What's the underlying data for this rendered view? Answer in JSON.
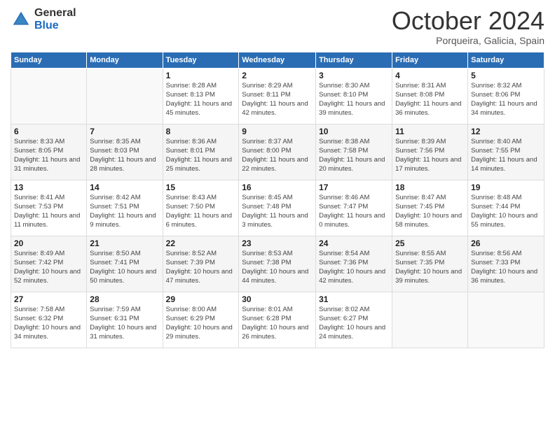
{
  "logo": {
    "general": "General",
    "blue": "Blue"
  },
  "header": {
    "month": "October 2024",
    "location": "Porqueira, Galicia, Spain"
  },
  "weekdays": [
    "Sunday",
    "Monday",
    "Tuesday",
    "Wednesday",
    "Thursday",
    "Friday",
    "Saturday"
  ],
  "weeks": [
    [
      {
        "day": "",
        "sunrise": "",
        "sunset": "",
        "daylight": ""
      },
      {
        "day": "",
        "sunrise": "",
        "sunset": "",
        "daylight": ""
      },
      {
        "day": "1",
        "sunrise": "Sunrise: 8:28 AM",
        "sunset": "Sunset: 8:13 PM",
        "daylight": "Daylight: 11 hours and 45 minutes."
      },
      {
        "day": "2",
        "sunrise": "Sunrise: 8:29 AM",
        "sunset": "Sunset: 8:11 PM",
        "daylight": "Daylight: 11 hours and 42 minutes."
      },
      {
        "day": "3",
        "sunrise": "Sunrise: 8:30 AM",
        "sunset": "Sunset: 8:10 PM",
        "daylight": "Daylight: 11 hours and 39 minutes."
      },
      {
        "day": "4",
        "sunrise": "Sunrise: 8:31 AM",
        "sunset": "Sunset: 8:08 PM",
        "daylight": "Daylight: 11 hours and 36 minutes."
      },
      {
        "day": "5",
        "sunrise": "Sunrise: 8:32 AM",
        "sunset": "Sunset: 8:06 PM",
        "daylight": "Daylight: 11 hours and 34 minutes."
      }
    ],
    [
      {
        "day": "6",
        "sunrise": "Sunrise: 8:33 AM",
        "sunset": "Sunset: 8:05 PM",
        "daylight": "Daylight: 11 hours and 31 minutes."
      },
      {
        "day": "7",
        "sunrise": "Sunrise: 8:35 AM",
        "sunset": "Sunset: 8:03 PM",
        "daylight": "Daylight: 11 hours and 28 minutes."
      },
      {
        "day": "8",
        "sunrise": "Sunrise: 8:36 AM",
        "sunset": "Sunset: 8:01 PM",
        "daylight": "Daylight: 11 hours and 25 minutes."
      },
      {
        "day": "9",
        "sunrise": "Sunrise: 8:37 AM",
        "sunset": "Sunset: 8:00 PM",
        "daylight": "Daylight: 11 hours and 22 minutes."
      },
      {
        "day": "10",
        "sunrise": "Sunrise: 8:38 AM",
        "sunset": "Sunset: 7:58 PM",
        "daylight": "Daylight: 11 hours and 20 minutes."
      },
      {
        "day": "11",
        "sunrise": "Sunrise: 8:39 AM",
        "sunset": "Sunset: 7:56 PM",
        "daylight": "Daylight: 11 hours and 17 minutes."
      },
      {
        "day": "12",
        "sunrise": "Sunrise: 8:40 AM",
        "sunset": "Sunset: 7:55 PM",
        "daylight": "Daylight: 11 hours and 14 minutes."
      }
    ],
    [
      {
        "day": "13",
        "sunrise": "Sunrise: 8:41 AM",
        "sunset": "Sunset: 7:53 PM",
        "daylight": "Daylight: 11 hours and 11 minutes."
      },
      {
        "day": "14",
        "sunrise": "Sunrise: 8:42 AM",
        "sunset": "Sunset: 7:51 PM",
        "daylight": "Daylight: 11 hours and 9 minutes."
      },
      {
        "day": "15",
        "sunrise": "Sunrise: 8:43 AM",
        "sunset": "Sunset: 7:50 PM",
        "daylight": "Daylight: 11 hours and 6 minutes."
      },
      {
        "day": "16",
        "sunrise": "Sunrise: 8:45 AM",
        "sunset": "Sunset: 7:48 PM",
        "daylight": "Daylight: 11 hours and 3 minutes."
      },
      {
        "day": "17",
        "sunrise": "Sunrise: 8:46 AM",
        "sunset": "Sunset: 7:47 PM",
        "daylight": "Daylight: 11 hours and 0 minutes."
      },
      {
        "day": "18",
        "sunrise": "Sunrise: 8:47 AM",
        "sunset": "Sunset: 7:45 PM",
        "daylight": "Daylight: 10 hours and 58 minutes."
      },
      {
        "day": "19",
        "sunrise": "Sunrise: 8:48 AM",
        "sunset": "Sunset: 7:44 PM",
        "daylight": "Daylight: 10 hours and 55 minutes."
      }
    ],
    [
      {
        "day": "20",
        "sunrise": "Sunrise: 8:49 AM",
        "sunset": "Sunset: 7:42 PM",
        "daylight": "Daylight: 10 hours and 52 minutes."
      },
      {
        "day": "21",
        "sunrise": "Sunrise: 8:50 AM",
        "sunset": "Sunset: 7:41 PM",
        "daylight": "Daylight: 10 hours and 50 minutes."
      },
      {
        "day": "22",
        "sunrise": "Sunrise: 8:52 AM",
        "sunset": "Sunset: 7:39 PM",
        "daylight": "Daylight: 10 hours and 47 minutes."
      },
      {
        "day": "23",
        "sunrise": "Sunrise: 8:53 AM",
        "sunset": "Sunset: 7:38 PM",
        "daylight": "Daylight: 10 hours and 44 minutes."
      },
      {
        "day": "24",
        "sunrise": "Sunrise: 8:54 AM",
        "sunset": "Sunset: 7:36 PM",
        "daylight": "Daylight: 10 hours and 42 minutes."
      },
      {
        "day": "25",
        "sunrise": "Sunrise: 8:55 AM",
        "sunset": "Sunset: 7:35 PM",
        "daylight": "Daylight: 10 hours and 39 minutes."
      },
      {
        "day": "26",
        "sunrise": "Sunrise: 8:56 AM",
        "sunset": "Sunset: 7:33 PM",
        "daylight": "Daylight: 10 hours and 36 minutes."
      }
    ],
    [
      {
        "day": "27",
        "sunrise": "Sunrise: 7:58 AM",
        "sunset": "Sunset: 6:32 PM",
        "daylight": "Daylight: 10 hours and 34 minutes."
      },
      {
        "day": "28",
        "sunrise": "Sunrise: 7:59 AM",
        "sunset": "Sunset: 6:31 PM",
        "daylight": "Daylight: 10 hours and 31 minutes."
      },
      {
        "day": "29",
        "sunrise": "Sunrise: 8:00 AM",
        "sunset": "Sunset: 6:29 PM",
        "daylight": "Daylight: 10 hours and 29 minutes."
      },
      {
        "day": "30",
        "sunrise": "Sunrise: 8:01 AM",
        "sunset": "Sunset: 6:28 PM",
        "daylight": "Daylight: 10 hours and 26 minutes."
      },
      {
        "day": "31",
        "sunrise": "Sunrise: 8:02 AM",
        "sunset": "Sunset: 6:27 PM",
        "daylight": "Daylight: 10 hours and 24 minutes."
      },
      {
        "day": "",
        "sunrise": "",
        "sunset": "",
        "daylight": ""
      },
      {
        "day": "",
        "sunrise": "",
        "sunset": "",
        "daylight": ""
      }
    ]
  ]
}
